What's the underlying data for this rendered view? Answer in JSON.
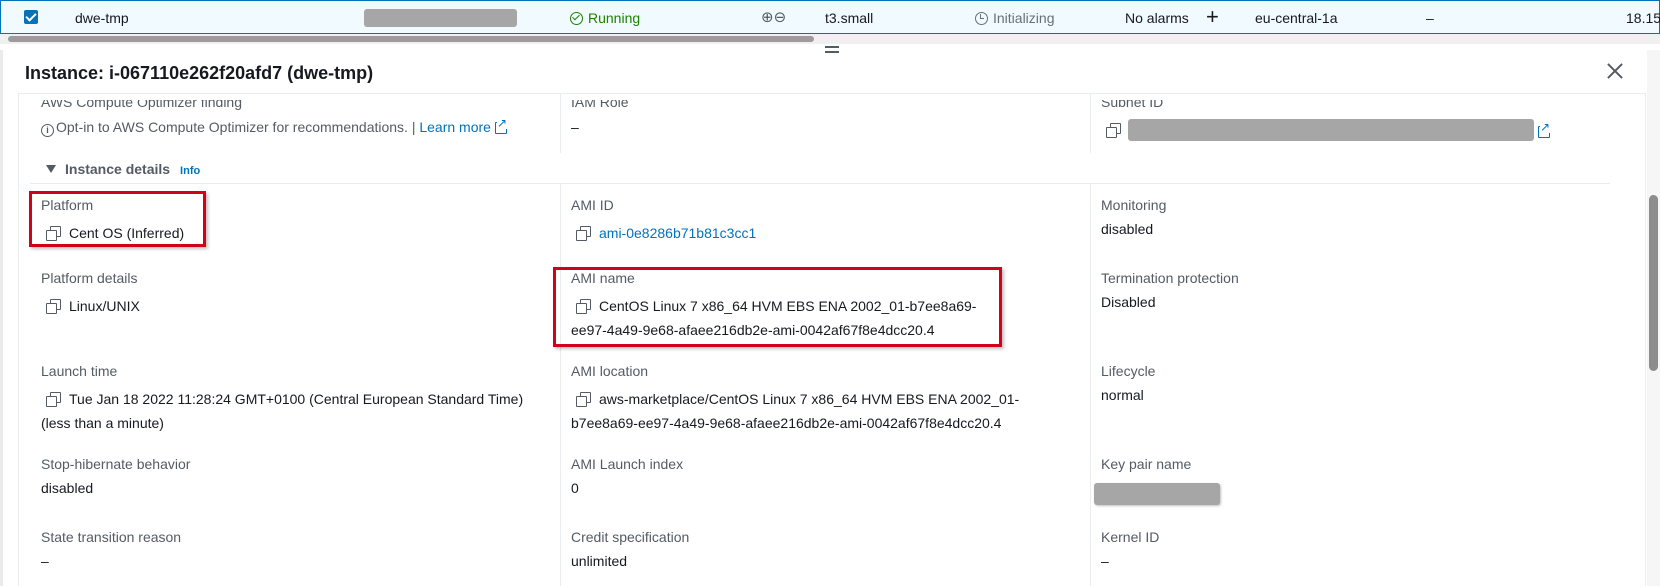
{
  "row": {
    "name": "dwe-tmp",
    "state": "Running",
    "instance_type": "t3.small",
    "status_check": "Initializing",
    "alarm_status": "No alarms",
    "availability_zone": "eu-central-1a",
    "public_dns": "–",
    "public_ip": "18.15"
  },
  "panel": {
    "title": "Instance: i-067110e262f20afd7 (dwe-tmp)"
  },
  "partial": {
    "optimizer_label": "AWS Compute Optimizer finding",
    "optimizer_text": "Opt-in to AWS Compute Optimizer for recommendations. |",
    "learn_more": "Learn more",
    "iam_label": "IAM Role",
    "iam_value": "–",
    "subnet_label": "Subnet ID"
  },
  "section": {
    "title": "Instance details",
    "info": "Info"
  },
  "details": {
    "platform_label": "Platform",
    "platform_value": "Cent OS (Inferred)",
    "ami_id_label": "AMI ID",
    "ami_id_value": "ami-0e8286b71b81c3cc1",
    "monitoring_label": "Monitoring",
    "monitoring_value": "disabled",
    "platform_details_label": "Platform details",
    "platform_details_value": "Linux/UNIX",
    "ami_name_label": "AMI name",
    "ami_name_line1": "CentOS Linux 7 x86_64 HVM EBS ENA 2002_01-b7ee8a69-",
    "ami_name_line2": "ee97-4a49-9e68-afaee216db2e-ami-0042af67f8e4dcc20.4",
    "termination_label": "Termination protection",
    "termination_value": "Disabled",
    "launch_label": "Launch time",
    "launch_line1": "Tue Jan 18 2022 11:28:24 GMT+0100 (Central European Standard Time)",
    "launch_line2": "(less than a minute)",
    "ami_location_label": "AMI location",
    "ami_location_line1": "aws-marketplace/CentOS Linux 7 x86_64 HVM EBS ENA 2002_01-",
    "ami_location_line2": "b7ee8a69-ee97-4a49-9e68-afaee216db2e-ami-0042af67f8e4dcc20.4",
    "lifecycle_label": "Lifecycle",
    "lifecycle_value": "normal",
    "stop_hib_label": "Stop-hibernate behavior",
    "stop_hib_value": "disabled",
    "ami_launch_index_label": "AMI Launch index",
    "ami_launch_index_value": "0",
    "key_pair_label": "Key pair name",
    "state_reason_label": "State transition reason",
    "state_reason_value": "–",
    "credit_label": "Credit specification",
    "credit_value": "unlimited",
    "kernel_label": "Kernel ID",
    "kernel_value": "–"
  },
  "colors": {
    "accent": "#0073bb",
    "running": "#1d8102",
    "highlight": "#d0021b"
  }
}
